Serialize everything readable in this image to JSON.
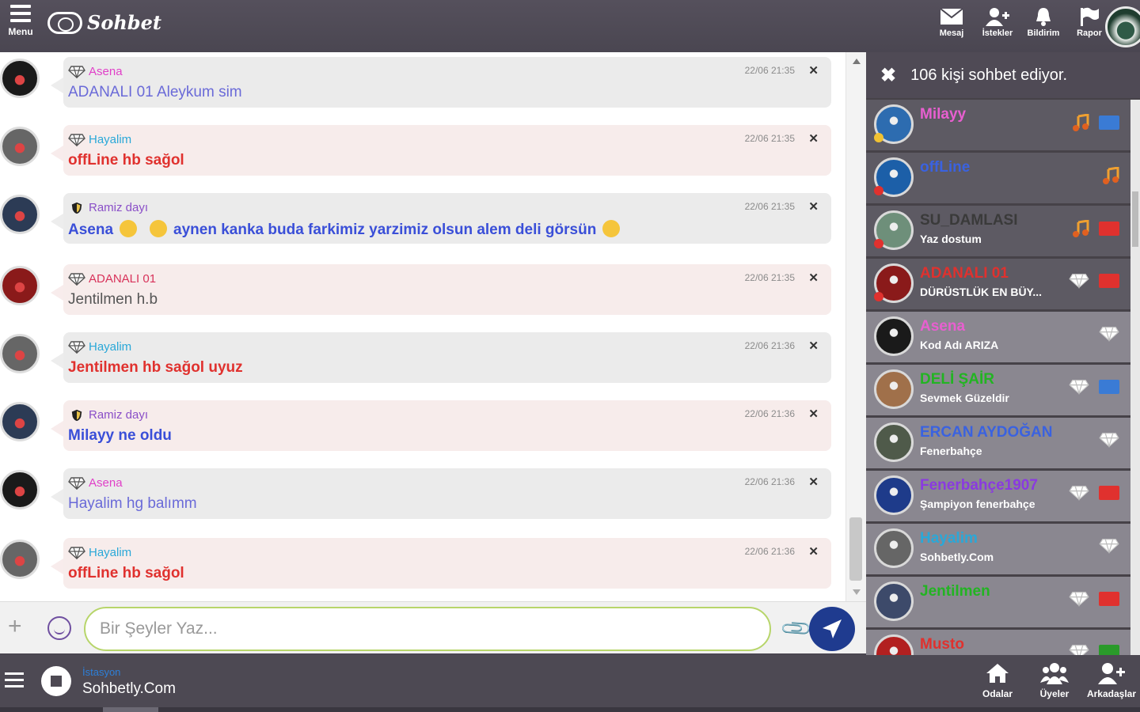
{
  "topbar": {
    "menu_label": "Menu",
    "logo_text": "Sohbet",
    "actions": [
      {
        "label": "Mesaj",
        "icon": "envelope-icon"
      },
      {
        "label": "İstekler",
        "icon": "add-user-icon"
      },
      {
        "label": "Bildirim",
        "icon": "bell-icon"
      },
      {
        "label": "Rapor",
        "icon": "flag-icon"
      }
    ]
  },
  "messages": [
    {
      "sender": "Asena",
      "sender_color": "#e040c8",
      "badge": "diamond-icon",
      "text": "ADANALI 01 Aleykum sim",
      "text_color": "#6a6ad8",
      "time": "22/06 21:35",
      "bubble": "grey",
      "avatar": "#1a1a1a"
    },
    {
      "sender": "Hayalim",
      "sender_color": "#2aa8d8",
      "badge": "diamond-icon",
      "text": "offLine hb sağol",
      "text_color": "#e0312e",
      "time": "22/06 21:35",
      "bubble": "pink",
      "avatar": "#666666"
    },
    {
      "sender": "Ramiz dayı",
      "sender_color": "#8a4fc8",
      "badge": "shield-icon",
      "text": "Asena",
      "text2": "aynen kanka buda farkimiz yarzimiz olsun alem deli görsün",
      "text_color": "#3a4fd8",
      "time": "22/06 21:35",
      "bubble": "grey",
      "avatar": "#2c3b55"
    },
    {
      "sender": "ADANALI 01",
      "sender_color": "#d8325a",
      "badge": "diamond-icon",
      "text": "Jentilmen h.b",
      "text_color": "#555555",
      "time": "22/06 21:35",
      "bubble": "pink",
      "avatar": "#8a1a1a"
    },
    {
      "sender": "Hayalim",
      "sender_color": "#2aa8d8",
      "badge": "diamond-icon",
      "text": "Jentilmen hb sağol uyuz",
      "text_color": "#e0312e",
      "time": "22/06 21:36",
      "bubble": "grey",
      "avatar": "#666666"
    },
    {
      "sender": "Ramiz dayı",
      "sender_color": "#8a4fc8",
      "badge": "shield-icon",
      "text": "Milayy ne oldu",
      "text_color": "#3a4fd8",
      "time": "22/06 21:36",
      "bubble": "pink",
      "avatar": "#2c3b55"
    },
    {
      "sender": "Asena",
      "sender_color": "#e040c8",
      "badge": "diamond-icon",
      "text": "Hayalim hg balımm",
      "text_color": "#6a6ad8",
      "time": "22/06 21:36",
      "bubble": "grey",
      "avatar": "#1a1a1a"
    },
    {
      "sender": "Hayalim",
      "sender_color": "#2aa8d8",
      "badge": "diamond-icon",
      "text": "offLine hb sağol",
      "text_color": "#e0312e",
      "time": "22/06 21:36",
      "bubble": "pink",
      "avatar": "#666666"
    }
  ],
  "input": {
    "placeholder": "Bir Şeyler Yaz..."
  },
  "panel": {
    "title": "106 kişi sohbet ediyor.",
    "users": [
      {
        "name": "Milayy",
        "name_color": "#e85fd0",
        "status": "",
        "icons": [
          "music-icon"
        ],
        "flag": "#3a7bd5",
        "avatar": "#2d6cb0",
        "dot": "#f1c232"
      },
      {
        "name": "offLine",
        "name_color": "#3a62e0",
        "status": "",
        "icons": [
          "music-icon"
        ],
        "flag": "",
        "avatar": "#1c5fa8",
        "dot": "#e0312e"
      },
      {
        "name": "SU_DAMLASI",
        "name_color": "#3a3a3a",
        "status": "Yaz dostum",
        "icons": [
          "music-icon"
        ],
        "flag": "#e0312e",
        "avatar": "#6e8f7a",
        "dot": "#e0312e"
      },
      {
        "name": "ADANALI 01",
        "name_color": "#e0312e",
        "status": "DÜRÜSTLÜK EN BÜY...",
        "icons": [
          "diamond-icon"
        ],
        "flag": "#e0312e",
        "avatar": "#8a1a1a",
        "dot": "#e0312e"
      },
      {
        "name": "Asena",
        "name_color": "#e85fd0",
        "status": "Kod Adı ARIZA",
        "icons": [
          "diamond-icon"
        ],
        "flag": "",
        "avatar": "#1a1a1a",
        "dot": ""
      },
      {
        "name": "DELİ ŞAİR",
        "name_color": "#22b422",
        "status": "Sevmek Güzeldir",
        "icons": [
          "diamond-icon"
        ],
        "flag": "#3a7bd5",
        "avatar": "#a0704a",
        "dot": ""
      },
      {
        "name": "ERCAN AYDOĞAN",
        "name_color": "#3a62e0",
        "status": "Fenerbahçe",
        "icons": [
          "diamond-icon"
        ],
        "flag": "",
        "avatar": "#4f5a4a",
        "dot": ""
      },
      {
        "name": "Fenerbahçe1907",
        "name_color": "#8a3ae0",
        "status": "Şampiyon fenerbahçe",
        "icons": [
          "diamond-icon"
        ],
        "flag": "#e0312e",
        "avatar": "#1e3b8a",
        "dot": ""
      },
      {
        "name": "Hayalim",
        "name_color": "#2aa8d8",
        "status": "Sohbetly.Com",
        "icons": [
          "diamond-icon"
        ],
        "flag": "",
        "avatar": "#666666",
        "dot": ""
      },
      {
        "name": "Jentilmen",
        "name_color": "#22b422",
        "status": "",
        "icons": [
          "diamond-icon"
        ],
        "flag": "#e0312e",
        "avatar": "#3d4a6a",
        "dot": ""
      },
      {
        "name": "Musto",
        "name_color": "#e0312e",
        "status": "",
        "icons": [
          "diamond-icon"
        ],
        "flag": "#2a9a2a",
        "avatar": "#b22020",
        "dot": ""
      }
    ]
  },
  "bottombar": {
    "station_label": "İstasyon",
    "station_name": "Sohbetly.Com",
    "actions": [
      {
        "label": "Odalar",
        "icon": "home-icon"
      },
      {
        "label": "Üyeler",
        "icon": "users-icon"
      },
      {
        "label": "Arkadaşlar",
        "icon": "add-friend-icon"
      }
    ]
  }
}
